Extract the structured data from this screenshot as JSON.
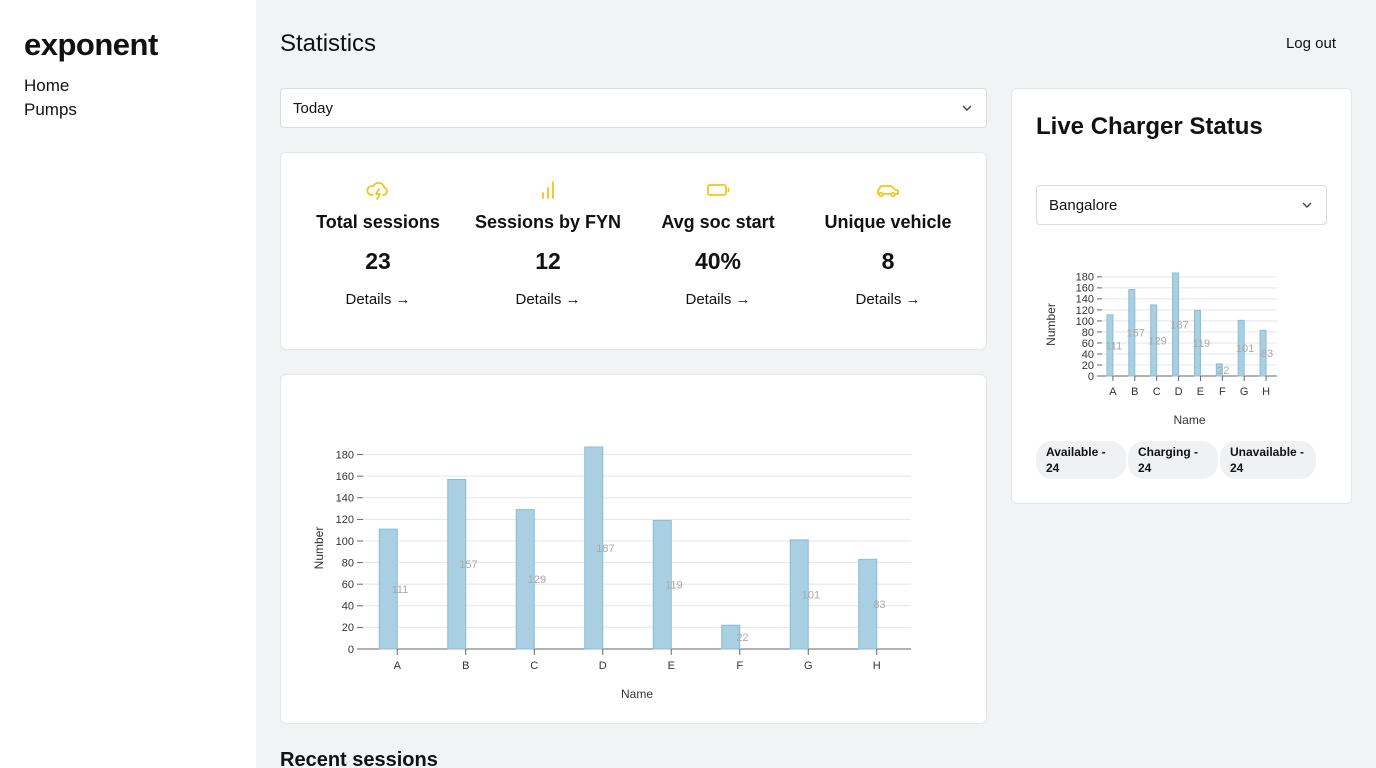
{
  "app": {
    "logo": "exponent"
  },
  "nav": {
    "items": [
      {
        "label": "Home"
      },
      {
        "label": "Pumps"
      }
    ]
  },
  "header": {
    "title": "Statistics",
    "logout_label": "Log out"
  },
  "period_select": {
    "value": "Today"
  },
  "stats": [
    {
      "icon": "storm-cloud-icon",
      "label": "Total sessions",
      "value": "23",
      "details": "Details →"
    },
    {
      "icon": "bar-signal-icon",
      "label": "Sessions by FYN",
      "value": "12",
      "details": "Details →"
    },
    {
      "icon": "battery-icon",
      "label": "Avg soc start",
      "value": "40%",
      "details": "Details →"
    },
    {
      "icon": "car-icon",
      "label": "Unique vehicle",
      "value": "8",
      "details": "Details →"
    }
  ],
  "colors": {
    "accent": "#f5c518",
    "bar": "#a8cfe2",
    "bar_stroke": "#8bbcd4",
    "grid": "#e3e5e8"
  },
  "chart_data": [
    {
      "type": "bar",
      "categories": [
        "A",
        "B",
        "C",
        "D",
        "E",
        "F",
        "G",
        "H"
      ],
      "values": [
        111,
        157,
        129,
        187,
        119,
        22,
        101,
        83
      ],
      "xlabel": "Name",
      "ylabel": "Number",
      "yticks": [
        0,
        20,
        40,
        60,
        80,
        100,
        120,
        140,
        160,
        180
      ],
      "ylim": [
        0,
        187
      ],
      "grid": true
    },
    {
      "type": "bar",
      "categories": [
        "A",
        "B",
        "C",
        "D",
        "E",
        "F",
        "G",
        "H"
      ],
      "values": [
        111,
        157,
        129,
        187,
        119,
        22,
        101,
        83
      ],
      "xlabel": "Name",
      "ylabel": "Number",
      "yticks": [
        0,
        20,
        40,
        60,
        80,
        100,
        120,
        140,
        160,
        180
      ],
      "ylim": [
        0,
        187
      ],
      "grid": true
    }
  ],
  "live": {
    "title": "Live Charger Status",
    "city_select": {
      "value": "Bangalore"
    },
    "badges": [
      {
        "label": "Available - 24"
      },
      {
        "label": "Charging - 24"
      },
      {
        "label": "Unavailable - 24"
      }
    ]
  },
  "recent": {
    "title": "Recent sessions"
  }
}
